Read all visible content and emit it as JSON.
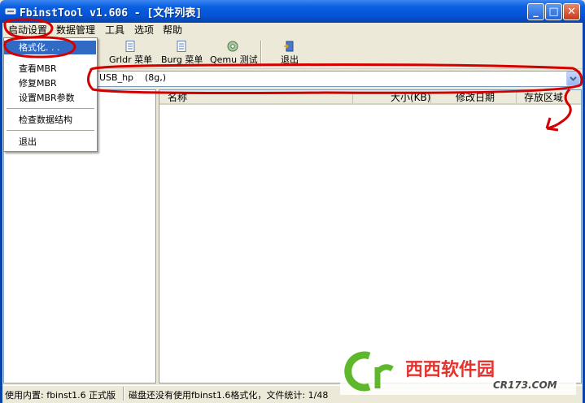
{
  "window": {
    "title": "FbinstTool v1.606 - [文件列表]",
    "minimize": "_",
    "maximize": "□",
    "close": "✕"
  },
  "menubar": {
    "items": [
      "启动设置",
      "数据管理",
      "工具",
      "选项",
      "帮助"
    ]
  },
  "dropdown": {
    "items": [
      "格式化. . .",
      "查看MBR",
      "修复MBR",
      "设置MBR参数",
      "检查数据结构",
      "退出"
    ],
    "highlighted_index": 0
  },
  "toolbar": {
    "partial_label": "单",
    "grldr_label": "Grldr 菜单",
    "burg_label": "Burg 菜单",
    "qemu_label": "Qemu 测试",
    "exit_label": "退出"
  },
  "device_combo": {
    "value": "USB_hp    (8g,)"
  },
  "file_list": {
    "columns": [
      "名称",
      "大小(KB)",
      "修改日期",
      "存放区域"
    ],
    "rows": []
  },
  "statusbar": {
    "left": "使用内置: fbinst1.6 正式版",
    "right": "磁盘还没有使用fbinst1.6格式化，文件统计: 1/48"
  },
  "watermark": {
    "brand": "西西软件园",
    "url": "CR173.COM",
    "logo_letters": "Cr"
  },
  "colors": {
    "titlebar": "#0553d6",
    "menu_highlight": "#316ac5",
    "annotation": "#d40000",
    "watermark_green": "#5fb82c",
    "watermark_red": "#e5322d"
  }
}
